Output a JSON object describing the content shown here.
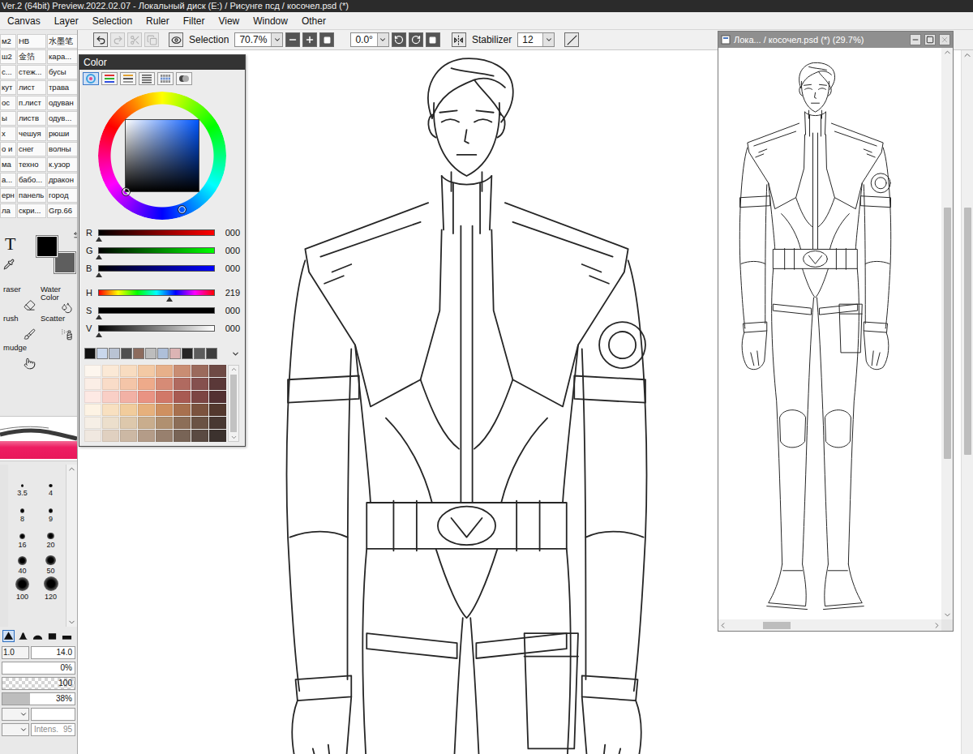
{
  "window": {
    "title": "Ver.2 (64bit) Preview.2022.02.07 - Локальный диск (E:) / Рисунге псд / косочел.psd (*)"
  },
  "menu": [
    "Canvas",
    "Layer",
    "Selection",
    "Ruler",
    "Filter",
    "View",
    "Window",
    "Other"
  ],
  "toolbar": {
    "history": [
      {
        "kind": "undo",
        "disabled": false
      },
      {
        "kind": "redo",
        "disabled": true
      },
      {
        "kind": "cut",
        "disabled": true
      },
      {
        "kind": "copy",
        "disabled": true
      }
    ],
    "selection_label": "Selection",
    "zoom": "70.7%",
    "rotation": "0.0°",
    "stabilizer_label": "Stabilizer",
    "stabilizer": "12"
  },
  "brush_textures": [
    "м2",
    "HB",
    "水墨笔",
    "ш2",
    "金箔",
    "кара...",
    "с...",
    "стеж...",
    "бусы",
    "кут",
    "лист",
    "трава",
    "ос",
    "п.лист",
    "одуван",
    "ы",
    "листв",
    "одув...",
    "х",
    "чешуя",
    "рюши",
    "о и",
    "снег",
    "волны",
    "ма",
    "техно",
    "к.узор",
    "а...",
    "бабо...",
    "дракон",
    "ерн",
    "панель",
    "город",
    "ла",
    "скри...",
    "Grp.66"
  ],
  "text_tool": "T",
  "color_boxes": {
    "primary": "#000000",
    "secondary": "#5e5e5e"
  },
  "tools": [
    {
      "label": "raser",
      "kind": "eraser"
    },
    {
      "label": "Water Color",
      "kind": "watercolor"
    },
    {
      "label": "rush",
      "kind": "brush"
    },
    {
      "label": "Scatter",
      "kind": "scatter"
    },
    {
      "label": "mudge",
      "kind": "smudge"
    }
  ],
  "brush_sizes": [
    {
      "label": "3.5"
    },
    {
      "label": "4"
    },
    {
      "label": "8"
    },
    {
      "label": "9"
    },
    {
      "label": "16"
    },
    {
      "label": "20"
    },
    {
      "label": "40"
    },
    {
      "label": "50"
    },
    {
      "label": "100"
    },
    {
      "label": "120"
    }
  ],
  "brush_shapes": [
    {
      "kind": "cone",
      "selected": true
    },
    {
      "kind": "bell",
      "selected": false
    },
    {
      "kind": "dome",
      "selected": false
    },
    {
      "kind": "square",
      "selected": false
    },
    {
      "kind": "bar",
      "selected": false
    }
  ],
  "brush_settings": [
    {
      "kind": "pair",
      "left": "1.0",
      "value": "14.0"
    },
    {
      "kind": "bar",
      "value": "0%",
      "level": 0
    },
    {
      "kind": "checker",
      "value": "100",
      "level": 1
    },
    {
      "kind": "bar",
      "value": "38%",
      "level": 0.38
    },
    {
      "kind": "select"
    },
    {
      "kind": "intensity",
      "label": "Intens.",
      "value": "95",
      "disabled": true
    }
  ],
  "color_panel": {
    "title": "Color",
    "tabs": [
      {
        "kind": "wheel",
        "selected": true
      },
      {
        "kind": "rgb",
        "selected": false
      },
      {
        "kind": "hsv",
        "selected": false
      },
      {
        "kind": "list",
        "selected": false
      },
      {
        "kind": "grid",
        "selected": false
      },
      {
        "kind": "mix",
        "selected": false
      }
    ],
    "sliders": [
      {
        "label": "R",
        "value": "000",
        "level": 0,
        "kind": "channel",
        "color": "#ff0000"
      },
      {
        "label": "G",
        "value": "000",
        "level": 0,
        "kind": "channel",
        "color": "#00ff00"
      },
      {
        "label": "B",
        "value": "000",
        "level": 0,
        "kind": "channel",
        "color": "#0000ff"
      },
      {
        "label": "H",
        "value": "219",
        "level": 0.61,
        "kind": "hue",
        "color": "#ff0000"
      },
      {
        "label": "S",
        "value": "000",
        "level": 0,
        "kind": "channel",
        "color": "#000000"
      },
      {
        "label": "V",
        "value": "000",
        "level": 0,
        "kind": "channel",
        "color": "#ffffff"
      }
    ],
    "swatches": [
      "#111111",
      "#c9d7ec",
      "#b9c3d3",
      "#4f4f4f",
      "#8c6b5d",
      "#bdbdbd",
      "#aebfd9",
      "#dcb4b4",
      "#262626",
      "#5c5c5c",
      "#3e3e3e"
    ],
    "palette": [
      "#fdf6ee",
      "#fbe9d6",
      "#f8dcc0",
      "#f3c9a4",
      "#e7b08a",
      "#c98d73",
      "#9b6a5c",
      "#6e4a45",
      "#fbeee6",
      "#f9dcc8",
      "#f4c5a8",
      "#eeaa8a",
      "#d68b76",
      "#b06a60",
      "#85504e",
      "#5a3838",
      "#fde9e4",
      "#f9cfc6",
      "#f2b1a5",
      "#e99383",
      "#d17868",
      "#a85a52",
      "#7c4543",
      "#533032",
      "#fdf3e4",
      "#f8e0c0",
      "#f1cc9c",
      "#e6b07c",
      "#cf9060",
      "#a8704e",
      "#7b523e",
      "#53382e",
      "#f6efe6",
      "#ecdfcc",
      "#ddc8ac",
      "#c9ad8d",
      "#b09070",
      "#8c6e58",
      "#6a5244",
      "#483832",
      "#f0e8e0",
      "#e0d0c0",
      "#ccb8a4",
      "#b49c88",
      "#98806e",
      "#786456",
      "#5a4a42",
      "#3c322e"
    ]
  },
  "navigator": {
    "title": "Лока... / косочел.psd (*) (29.7%)",
    "buttons": [
      {
        "kind": "minimize",
        "disabled": false
      },
      {
        "kind": "maximize",
        "disabled": false
      },
      {
        "kind": "close",
        "disabled": true
      }
    ]
  }
}
